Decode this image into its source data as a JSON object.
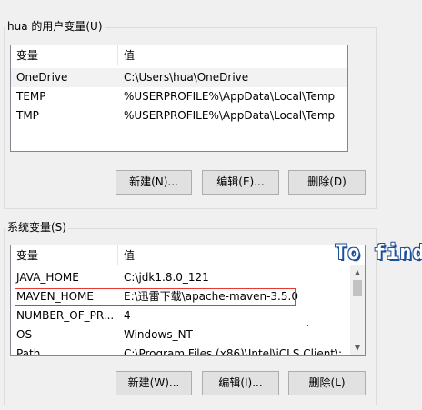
{
  "user_vars": {
    "title": "hua 的用户变量(U)",
    "col_variable": "变量",
    "col_value": "值",
    "rows": [
      {
        "name": "OneDrive",
        "value": "C:\\Users\\hua\\OneDrive"
      },
      {
        "name": "TEMP",
        "value": "%USERPROFILE%\\AppData\\Local\\Temp"
      },
      {
        "name": "TMP",
        "value": "%USERPROFILE%\\AppData\\Local\\Temp"
      }
    ],
    "btn_new": "新建(N)...",
    "btn_edit": "编辑(E)...",
    "btn_delete": "删除(D)"
  },
  "system_vars": {
    "title": "系统变量(S)",
    "col_variable": "变量",
    "col_value": "值",
    "rows": [
      {
        "name": "JAVA_HOME",
        "value": "C:\\jdk1.8.0_121"
      },
      {
        "name": "MAVEN_HOME",
        "value": "E:\\迅雷下载\\apache-maven-3.5.0"
      },
      {
        "name": "NUMBER_OF_PR...",
        "value": "4"
      },
      {
        "name": "OS",
        "value": "Windows_NT"
      },
      {
        "name": "Path",
        "value": "C:\\Program Files (x86)\\Intel\\iCLS Client\\;..."
      }
    ],
    "btn_new": "新建(W)...",
    "btn_edit": "编辑(I)...",
    "btn_delete": "删除(L)"
  },
  "overlay": {
    "text": "To find"
  },
  "colors": {
    "highlight_border": "#e53935",
    "overlay_outline": "#1c4f9a"
  },
  "icons": {
    "scroll_up": "chevron-up-icon",
    "scroll_down": "chevron-down-icon"
  }
}
